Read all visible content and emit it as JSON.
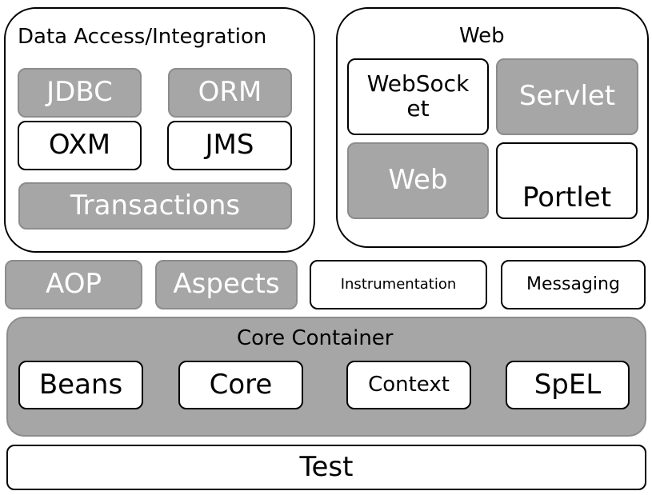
{
  "data_access": {
    "title": "Data Access/Integration",
    "jdbc": "JDBC",
    "orm": "ORM",
    "oxm": "OXM",
    "jms": "JMS",
    "transactions": "Transactions"
  },
  "web": {
    "title": "Web",
    "websocket": "WebSock\net",
    "servlet": "Servlet",
    "web": "Web",
    "portlet": "Portlet"
  },
  "middle": {
    "aop": "AOP",
    "aspects": "Aspects",
    "instrumentation": "Instrumentation",
    "messaging": "Messaging"
  },
  "core": {
    "title": "Core Container",
    "beans": "Beans",
    "core": "Core",
    "context": "Context",
    "spel": "SpEL"
  },
  "test": "Test",
  "colors": {
    "highlight": "#a6a6a6",
    "plain": "#ffffff"
  }
}
